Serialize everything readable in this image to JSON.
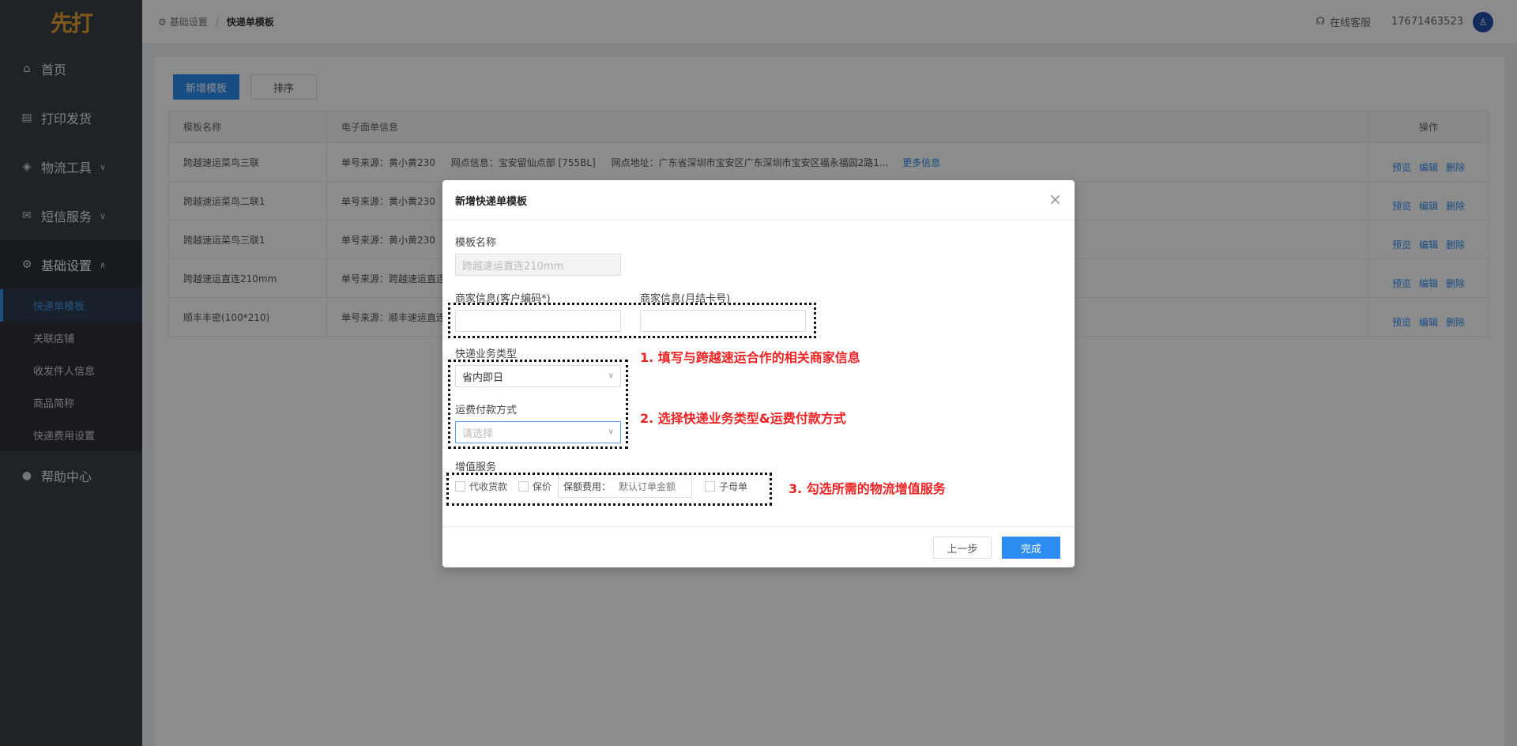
{
  "logo": "先打",
  "sidebar": {
    "items": [
      {
        "label": "首页",
        "icon": "home-icon"
      },
      {
        "label": "打印发货",
        "icon": "printer-icon"
      },
      {
        "label": "物流工具",
        "icon": "box-icon"
      },
      {
        "label": "短信服务",
        "icon": "mail-icon"
      },
      {
        "label": "基础设置",
        "icon": "gear-icon"
      }
    ],
    "submenu": [
      {
        "label": "快递单模板",
        "active": true
      },
      {
        "label": "关联店铺"
      },
      {
        "label": "收发件人信息"
      },
      {
        "label": "商品简称"
      },
      {
        "label": "快递费用设置"
      }
    ],
    "help": {
      "label": "帮助中心",
      "icon": "help-icon"
    }
  },
  "header": {
    "breadcrumb": [
      "基础设置",
      "快递单模板"
    ],
    "service": "在线客服",
    "phone": "17671463523"
  },
  "toolbar": {
    "add_label": "新增模板",
    "sort_label": "排序"
  },
  "table": {
    "headers": [
      "模板名称",
      "电子面单信息",
      "操作"
    ],
    "rows": [
      {
        "name": "跨越速运菜鸟三联",
        "source": "单号来源：黄小黄230",
        "point": "网点信息：宝安留仙点部 [755BL]",
        "address": "网点地址：广东省深圳市宝安区广东深圳市宝安区福永福园2路1...",
        "more": "更多信息"
      },
      {
        "name": "跨越速运菜鸟二联1",
        "source": "单号来源：黄小黄230"
      },
      {
        "name": "跨越速运菜鸟三联1",
        "source": "单号来源：黄小黄230"
      },
      {
        "name": "跨越速运直连210mm",
        "source": "单号来源：跨越速运直连"
      },
      {
        "name": "顺丰丰密(100*210)",
        "source": "单号来源：顺丰速运直连"
      }
    ],
    "ops": [
      "预览",
      "编辑",
      "删除"
    ]
  },
  "modal": {
    "title": "新增快递单模板",
    "template_name_label": "模板名称",
    "template_name_value": "跨越速运直连210mm",
    "merchant_code_label": "商家信息(客户编码*)",
    "merchant_card_label": "商家信息(月结卡号)",
    "biz_type_label": "快递业务类型",
    "biz_type_value": "省内即日",
    "payment_label": "运费付款方式",
    "payment_placeholder": "请选择",
    "value_added_label": "增值服务",
    "cod_label": "代收货款",
    "insure_label": "保价",
    "insure_fee_label": "保额费用：",
    "insure_fee_placeholder": "默认订单金额",
    "sub_order_label": "子母单",
    "back_label": "上一步",
    "done_label": "完成"
  },
  "notes": {
    "n1": "1. 填写与跨越速运合作的相关商家信息",
    "n2": "2. 选择快递业务类型&运费付款方式",
    "n3": "3. 勾选所需的物流增值服务"
  }
}
